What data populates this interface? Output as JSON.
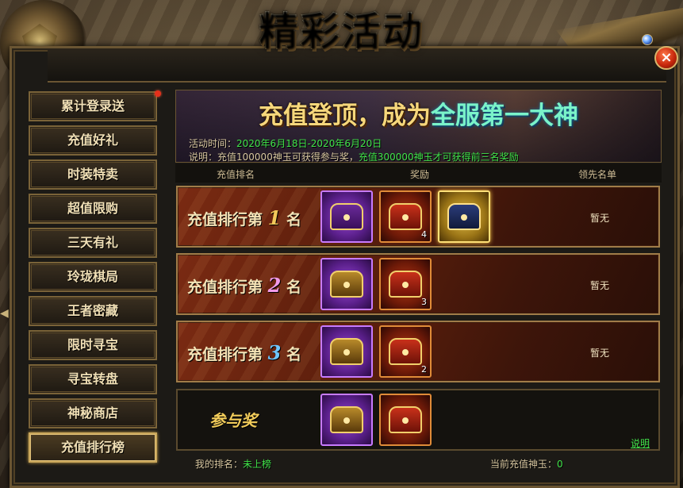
{
  "title": "精彩活动",
  "close_label": "×",
  "sidebar": {
    "items": [
      {
        "label": "累计登录送"
      },
      {
        "label": "充值好礼"
      },
      {
        "label": "时装特卖"
      },
      {
        "label": "超值限购"
      },
      {
        "label": "三天有礼"
      },
      {
        "label": "玲珑棋局"
      },
      {
        "label": "王者密藏"
      },
      {
        "label": "限时寻宝"
      },
      {
        "label": "寻宝转盘"
      },
      {
        "label": "神秘商店"
      },
      {
        "label": "充值排行榜"
      }
    ],
    "active_index": 10
  },
  "banner": {
    "headline_part1": "充值登顶，成为",
    "headline_highlight": "全服第一大神",
    "time_label": "活动时间：",
    "time_value": "2020年6月18日-2020年6月20日",
    "desc_label": "说明：",
    "desc_part1": "充值100000神玉可获得参与奖，",
    "desc_part2": "充值300000神玉才可获得前三名奖励"
  },
  "columns": {
    "rank": "充值排名",
    "reward": "奖励",
    "leader": "领先名单"
  },
  "ranks": [
    {
      "prefix": "充值排行第",
      "num": "1",
      "suffix": "名",
      "status": "暂无",
      "rewards": [
        {
          "type": "purple",
          "count": ""
        },
        {
          "type": "red",
          "count": "4"
        },
        {
          "type": "gold",
          "count": ""
        }
      ]
    },
    {
      "prefix": "充值排行第",
      "num": "2",
      "suffix": "名",
      "status": "暂无",
      "rewards": [
        {
          "type": "purple",
          "count": ""
        },
        {
          "type": "red",
          "count": "3"
        }
      ]
    },
    {
      "prefix": "充值排行第",
      "num": "3",
      "suffix": "名",
      "status": "暂无",
      "rewards": [
        {
          "type": "purple",
          "count": ""
        },
        {
          "type": "red",
          "count": "2"
        }
      ]
    }
  ],
  "participation": {
    "label": "参与奖",
    "explain": "说明"
  },
  "footer": {
    "my_rank_label": "我的排名：",
    "my_rank_value": "未上榜",
    "current_label": "当前充值神玉：",
    "current_value": "0"
  },
  "colors": {
    "accent_green": "#41e34a",
    "gold": "#f2c85a",
    "frame": "#6a5532"
  }
}
